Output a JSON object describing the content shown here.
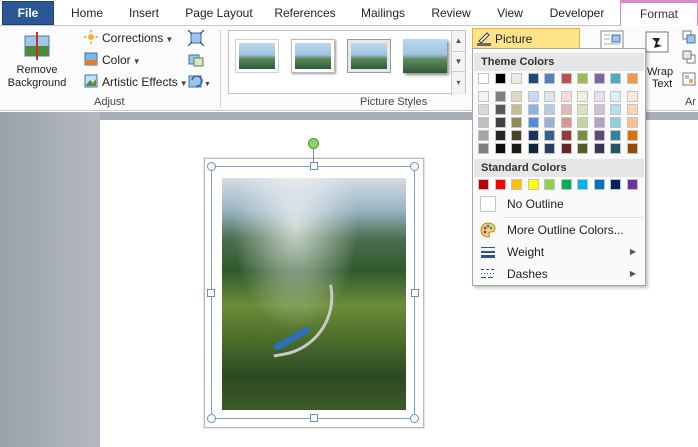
{
  "tabs": [
    {
      "id": "file",
      "label": "File"
    },
    {
      "id": "home",
      "label": "Home"
    },
    {
      "id": "insert",
      "label": "Insert"
    },
    {
      "id": "page-layout",
      "label": "Page Layout"
    },
    {
      "id": "references",
      "label": "References"
    },
    {
      "id": "mailings",
      "label": "Mailings"
    },
    {
      "id": "review",
      "label": "Review"
    },
    {
      "id": "view",
      "label": "View"
    },
    {
      "id": "developer",
      "label": "Developer"
    },
    {
      "id": "format",
      "label": "Format"
    }
  ],
  "ribbon": {
    "adjust": {
      "group_label": "Adjust",
      "remove_background_line1": "Remove",
      "remove_background_line2": "Background",
      "corrections": "Corrections",
      "color": "Color",
      "artistic_effects": "Artistic Effects"
    },
    "picture_styles": {
      "group_label": "Picture Styles",
      "picture_border": "Picture Border"
    },
    "arrange": {
      "wrap_line1": "Wrap",
      "wrap_line2": "Text",
      "group_label_partial": "Ar"
    }
  },
  "dropdown": {
    "theme_colors_label": "Theme Colors",
    "standard_colors_label": "Standard Colors",
    "theme_top_row": [
      "#ffffff",
      "#000000",
      "#eeece1",
      "#1f497d",
      "#4f81bd",
      "#c0504d",
      "#9bbb59",
      "#8064a2",
      "#4bacc6",
      "#f79646"
    ],
    "theme_shades": [
      [
        "#f2f2f2",
        "#7f7f7f",
        "#ddd9c3",
        "#c6d9f0",
        "#dbe5f1",
        "#f2dcdb",
        "#ebf1dd",
        "#e5e0ec",
        "#dbeef3",
        "#fdeada"
      ],
      [
        "#d8d8d8",
        "#595959",
        "#c4bd97",
        "#8db3e2",
        "#b8cce4",
        "#e5b9b7",
        "#d7e3bc",
        "#ccc1d9",
        "#b7dde8",
        "#fbd5b5"
      ],
      [
        "#bfbfbf",
        "#3f3f3f",
        "#938953",
        "#548dd4",
        "#95b3d7",
        "#d99694",
        "#c3d69b",
        "#b2a2c7",
        "#92cddc",
        "#fac08f"
      ],
      [
        "#a5a5a5",
        "#262626",
        "#494429",
        "#17365d",
        "#366092",
        "#953734",
        "#76923c",
        "#5f497a",
        "#31859b",
        "#e36c09"
      ],
      [
        "#7f7f7f",
        "#0c0c0c",
        "#1d1b10",
        "#0f243e",
        "#244061",
        "#632423",
        "#4f6128",
        "#3f3151",
        "#205867",
        "#974806"
      ]
    ],
    "standard_colors": [
      "#c00000",
      "#ff0000",
      "#ffc000",
      "#ffff00",
      "#92d050",
      "#00b050",
      "#00b0f0",
      "#0070c0",
      "#002060",
      "#7030a0"
    ],
    "no_outline": "No Outline",
    "more_outline_colors": "More Outline Colors...",
    "weight": "Weight",
    "dashes": "Dashes"
  }
}
